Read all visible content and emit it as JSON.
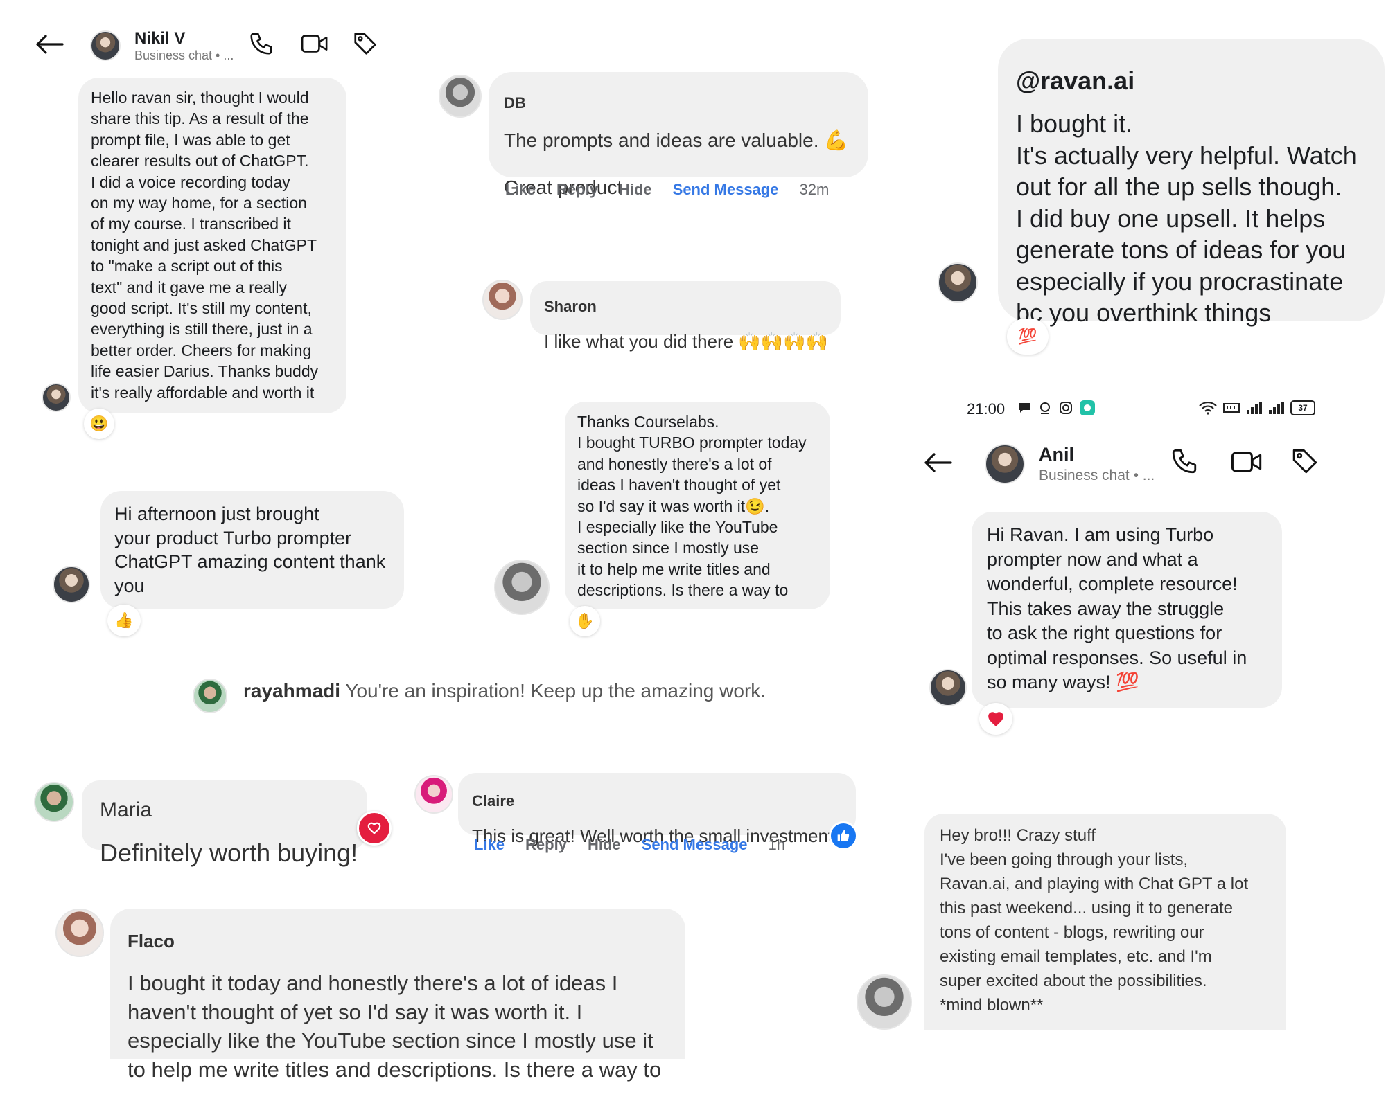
{
  "nikil": {
    "name": "Nikil V",
    "subtitle": "Business chat • ...",
    "message": "Hello ravan sir, thought I would\nshare this tip. As a result of the\nprompt file, I was able to get\nclearer results out of ChatGPT.\nI did a voice recording today\non my way home, for a section\nof my course. I transcribed it\ntonight and just asked ChatGPT\nto \"make a script out of this\ntext\" and it gave me a really\ngood script. It's still my content,\neverything is still there, just in a\nbetter order. Cheers for making\nlife easier Darius. Thanks buddy\nit's really affordable and worth it",
    "reaction": "😃"
  },
  "db": {
    "name": "DB",
    "line1": "The prompts and ideas are valuable. 💪",
    "line2": "Great product",
    "actions": {
      "like": "Like",
      "reply": "Reply",
      "hide": "Hide",
      "send": "Send Message",
      "time": "32m"
    }
  },
  "sharon": {
    "name": "Sharon",
    "message": "I like what you did there 🙌🙌🙌🙌"
  },
  "ravan_review": {
    "handle": "@ravan.ai",
    "message": "I bought it.\nIt's actually very helpful. Watch\nout for all the up sells though.\nI did buy one upsell. It helps\ngenerate tons of ideas for you\nespecially if you procrastinate\nbc you overthink things",
    "reaction": "💯"
  },
  "courselabs": {
    "message": "Thanks Courselabs.\nI bought TURBO prompter today\nand honestly there's a lot of\nideas I haven't thought of yet\nso I'd say it was worth it😉.\nI especially like the YouTube\nsection since I mostly use\nit to help me write titles and\ndescriptions. Is there a way to",
    "reaction": "✋"
  },
  "phone_status": {
    "time": "21:00",
    "battery": "37"
  },
  "anil": {
    "name": "Anil",
    "subtitle": "Business chat • ...",
    "message": "Hi Ravan. I am using Turbo\nprompter now and what a\nwonderful, complete resource!\nThis takes away the struggle\nto ask the right questions for\noptimal responses. So useful in\nso many ways! 💯",
    "reaction": "❤️"
  },
  "afternoon": {
    "message": "Hi afternoon just brought\nyour product Turbo prompter\nChatGPT amazing content thank\nyou",
    "reaction": "👍"
  },
  "rayahmadi": {
    "name": "rayahmadi",
    "message": "You're an inspiration! Keep up the amazing work."
  },
  "maria": {
    "name": "Maria",
    "message": "Definitely worth buying!"
  },
  "claire": {
    "name": "Claire",
    "message": "This is great! Well worth the small investment",
    "actions": {
      "like": "Like",
      "reply": "Reply",
      "hide": "Hide",
      "send": "Send Message",
      "time": "1h"
    }
  },
  "flaco": {
    "name": "Flaco",
    "message": "I bought it today and honestly there's a lot of ideas I\nhaven't thought of yet so I'd say it was worth it. I\nespecially like the YouTube section since I mostly use it\nto help me write titles and descriptions. Is there a way to"
  },
  "bro": {
    "message": "Hey bro!!! Crazy stuff\nI've been going through your lists,\nRavan.ai, and playing with Chat GPT a lot\nthis past  weekend... using it to generate\ntons of content - blogs, rewriting our\nexisting email templates, etc. and I'm\nsuper excited about the possibilities.\n*mind blown**"
  },
  "colors": {
    "bubble": "#f0f0f0",
    "link_blue": "#3578e5",
    "action_grey": "#65676b",
    "heart_red": "#e41e3f"
  }
}
